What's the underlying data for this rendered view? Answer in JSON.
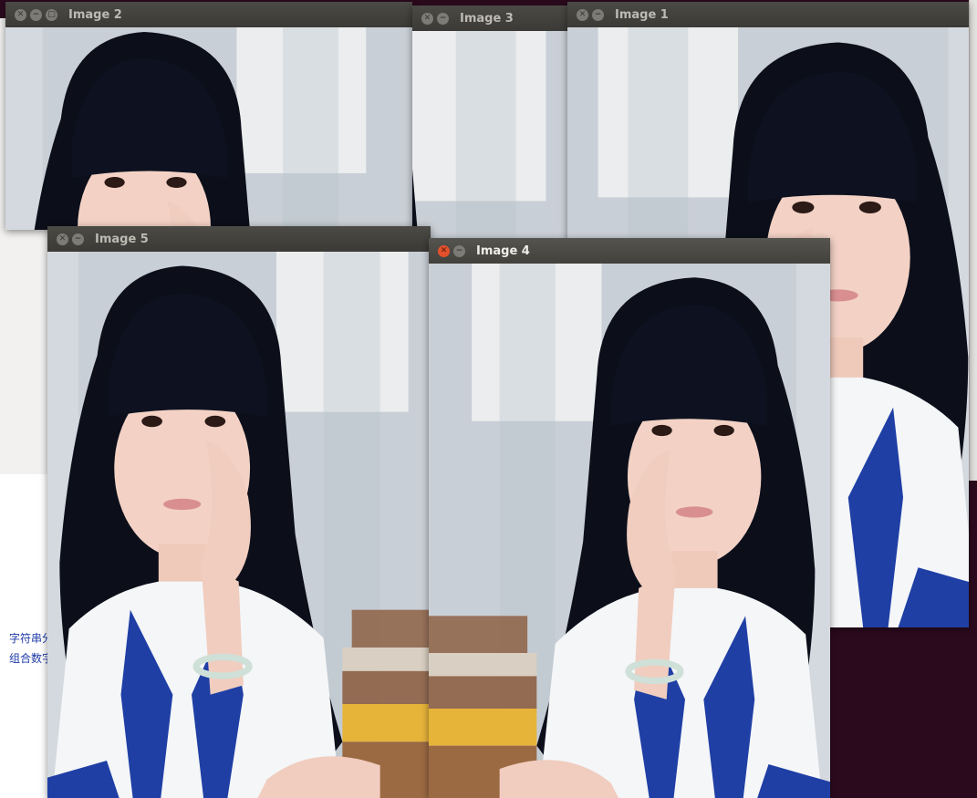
{
  "background": {
    "desktop_color": "#2c0a1e",
    "text_lines": [
      "字符串分",
      "组合数字"
    ]
  },
  "windows": [
    {
      "id": "image2",
      "title": "Image 2",
      "controls": [
        "close",
        "minimize",
        "maximize"
      ],
      "active": false
    },
    {
      "id": "image3",
      "title": "Image 3",
      "controls": [
        "close",
        "minimize"
      ],
      "active": false
    },
    {
      "id": "image1",
      "title": "Image 1",
      "controls": [
        "close",
        "minimize"
      ],
      "active": false
    },
    {
      "id": "image5",
      "title": "Image 5",
      "controls": [
        "close",
        "minimize"
      ],
      "active": false
    },
    {
      "id": "image4",
      "title": "Image 4",
      "controls": [
        "close",
        "minimize"
      ],
      "active": true
    }
  ],
  "photo": {
    "subject": "portrait-girl-long-black-hair",
    "colors": {
      "hair": "#0c0f1a",
      "skin": "#f3d2c5",
      "wall": "#c9cfd6",
      "window_light": "#eef0f1",
      "uniform_blue": "#1f3fa5",
      "shirt_white": "#f4f6f8",
      "desk_yellow": "#e7b43a",
      "desk_brown": "#8b5a3c"
    }
  }
}
